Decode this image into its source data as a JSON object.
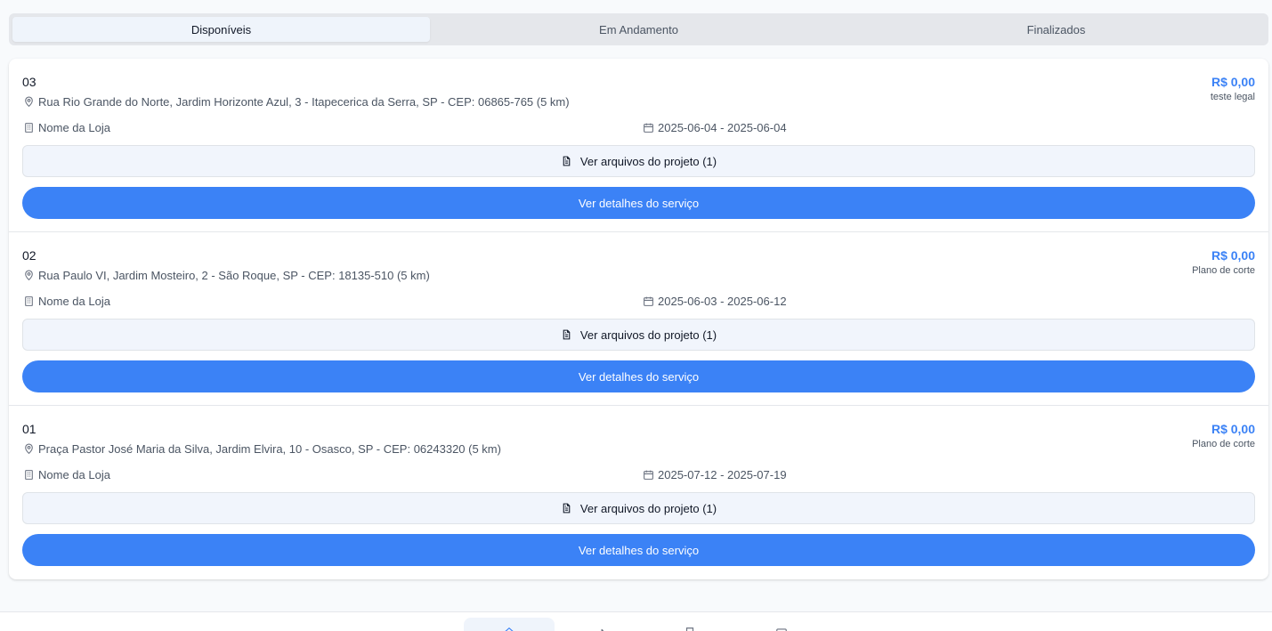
{
  "tabs": [
    {
      "label": "Disponíveis",
      "active": true
    },
    {
      "label": "Em Andamento",
      "active": false
    },
    {
      "label": "Finalizados",
      "active": false
    }
  ],
  "services": [
    {
      "title": "03",
      "price": "R$ 0,00",
      "plan": "teste legal",
      "address": "Rua Rio Grande do Norte, Jardim Horizonte Azul, 3 - Itapecerica da Serra, SP - CEP: 06865-765 (5 km)",
      "store": "Nome da Loja",
      "dates": "2025-06-04 - 2025-06-04",
      "files_label": "Ver arquivos do projeto (1)",
      "details_label": "Ver detalhes do serviço"
    },
    {
      "title": "02",
      "price": "R$ 0,00",
      "plan": "Plano de corte",
      "address": "Rua Paulo VI, Jardim Mosteiro, 2 - São Roque, SP - CEP: 18135-510 (5 km)",
      "store": "Nome da Loja",
      "dates": "2025-06-03 - 2025-06-12",
      "files_label": "Ver arquivos do projeto (1)",
      "details_label": "Ver detalhes do serviço"
    },
    {
      "title": "01",
      "price": "R$ 0,00",
      "plan": "Plano de corte",
      "address": "Praça Pastor José Maria da Silva, Jardim Elvira, 10 - Osasco, SP - CEP: 06243320 (5 km)",
      "store": "Nome da Loja",
      "dates": "2025-07-12 - 2025-07-19",
      "files_label": "Ver arquivos do projeto (1)",
      "details_label": "Ver detalhes do serviço"
    }
  ],
  "bottom_nav": [
    {
      "icon": "home-icon",
      "active": true
    },
    {
      "icon": "wrench-icon",
      "active": false
    },
    {
      "icon": "bookmark-icon",
      "active": false
    },
    {
      "icon": "calendar-icon",
      "active": false
    }
  ],
  "colors": {
    "accent": "#3b82f6",
    "tab_bar": "#e5e7eb",
    "active_tab": "#eff4fb"
  }
}
